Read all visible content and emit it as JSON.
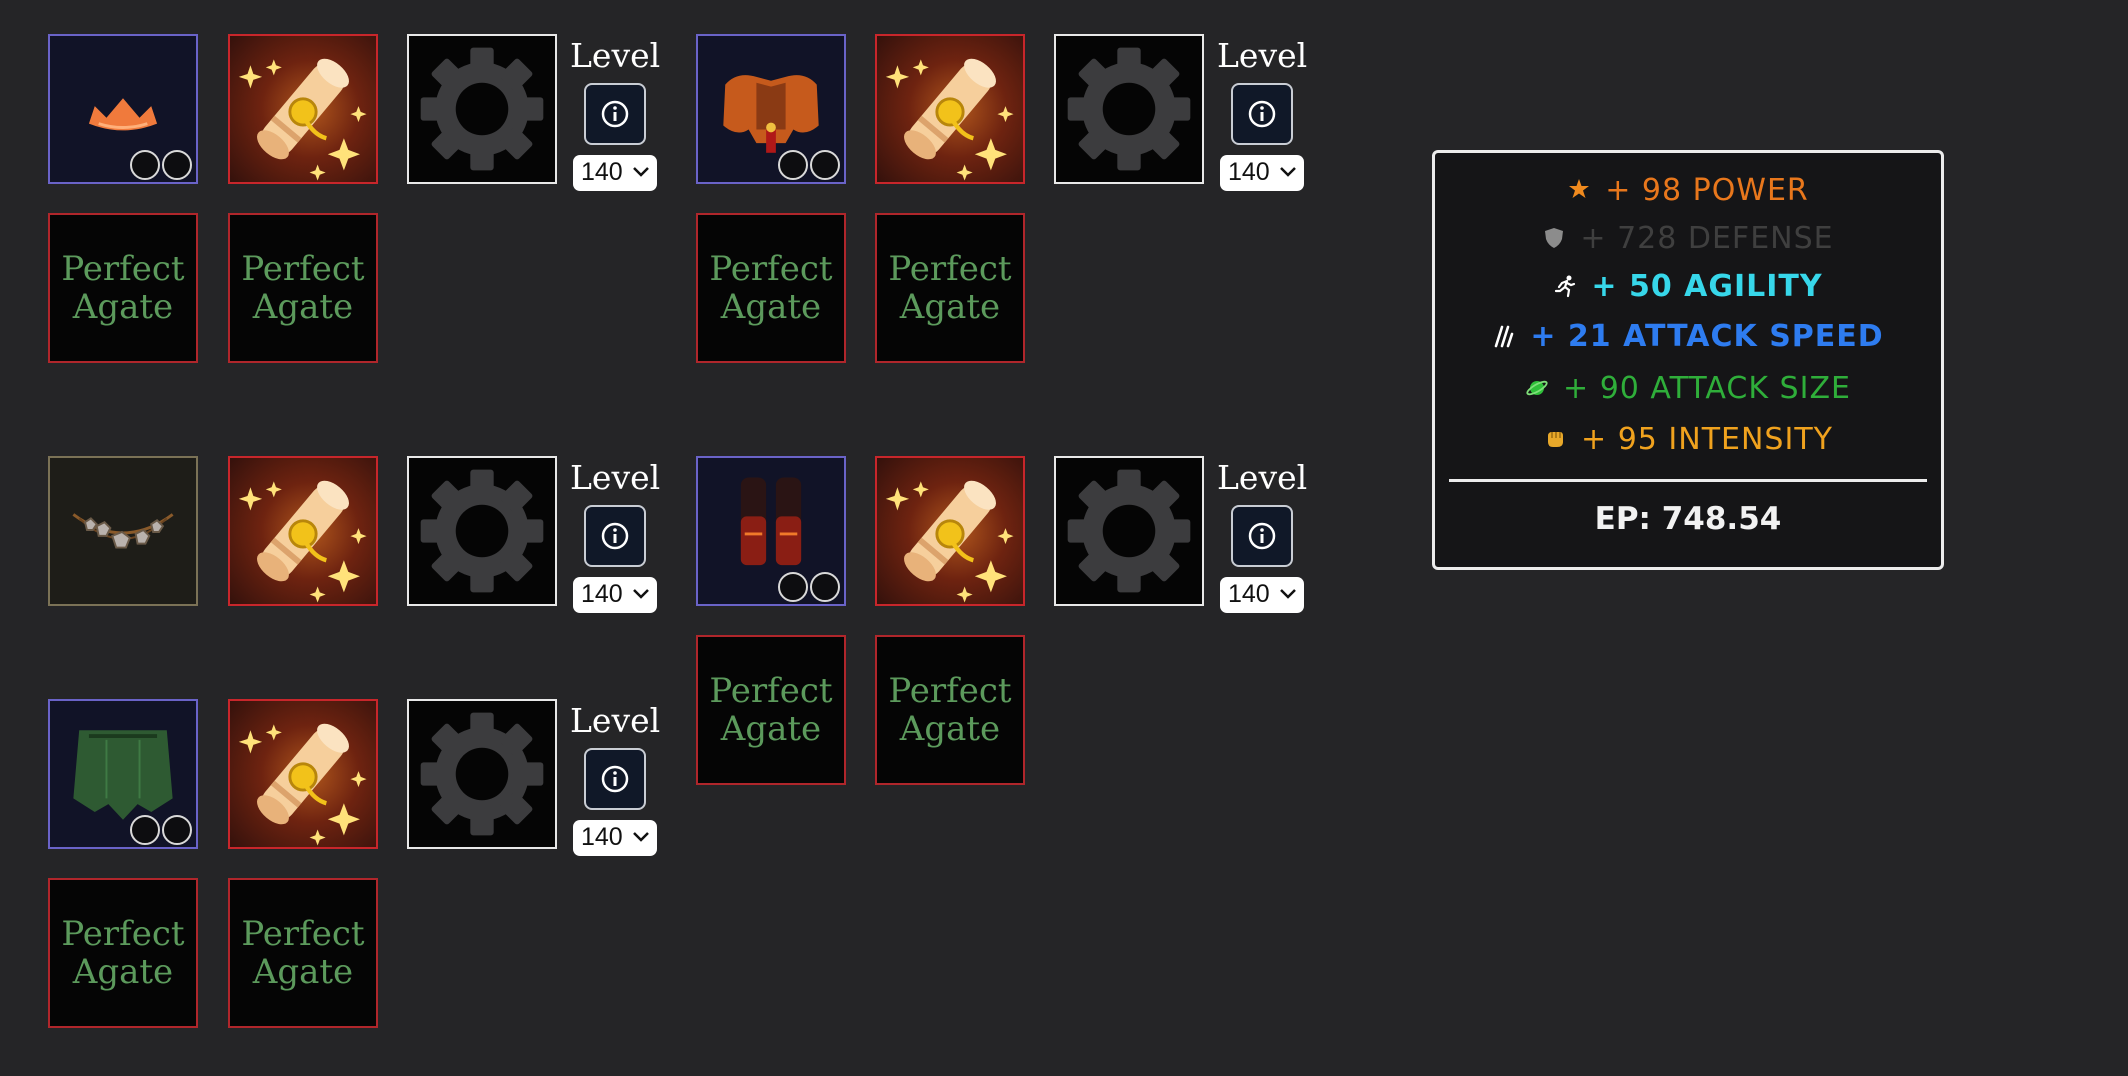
{
  "level_label": "Level",
  "level_value": "140",
  "gem_label_line1": "Perfect",
  "gem_label_line2": "Agate",
  "icons": {
    "info": "info-circle-icon",
    "dropdown": "chevron-down-icon",
    "gear": "gear-icon",
    "scroll": "enchant-scroll-icon",
    "socket": "gem-socket-icon"
  },
  "equipment": [
    {
      "slot": "head",
      "item_icon": "helmet-crown-icon"
    },
    {
      "slot": "chest",
      "item_icon": "chest-armor-icon"
    },
    {
      "slot": "neck",
      "item_icon": "necklace-icon"
    },
    {
      "slot": "feet",
      "item_icon": "boots-icon"
    },
    {
      "slot": "legs",
      "item_icon": "leg-armor-icon"
    }
  ],
  "stats": {
    "lines": [
      {
        "text": "+ 98 POWER",
        "color": "#e8771c",
        "icon": "power-star-icon"
      },
      {
        "text": "+ 728 DEFENSE",
        "color": "#3f3f3f",
        "icon": "shield-icon"
      },
      {
        "text": "+ 50 AGILITY",
        "color": "#37d7ea",
        "icon": "running-man-icon"
      },
      {
        "text": "+ 21 ATTACK SPEED",
        "color": "#2e7cf0",
        "icon": "claw-slash-icon"
      },
      {
        "text": "+ 90 ATTACK SIZE",
        "color": "#2fae3a",
        "icon": "planet-icon"
      },
      {
        "text": "+ 95 INTENSITY",
        "color": "#f0a21e",
        "icon": "fist-icon"
      }
    ],
    "ep": "EP: 748.54"
  }
}
